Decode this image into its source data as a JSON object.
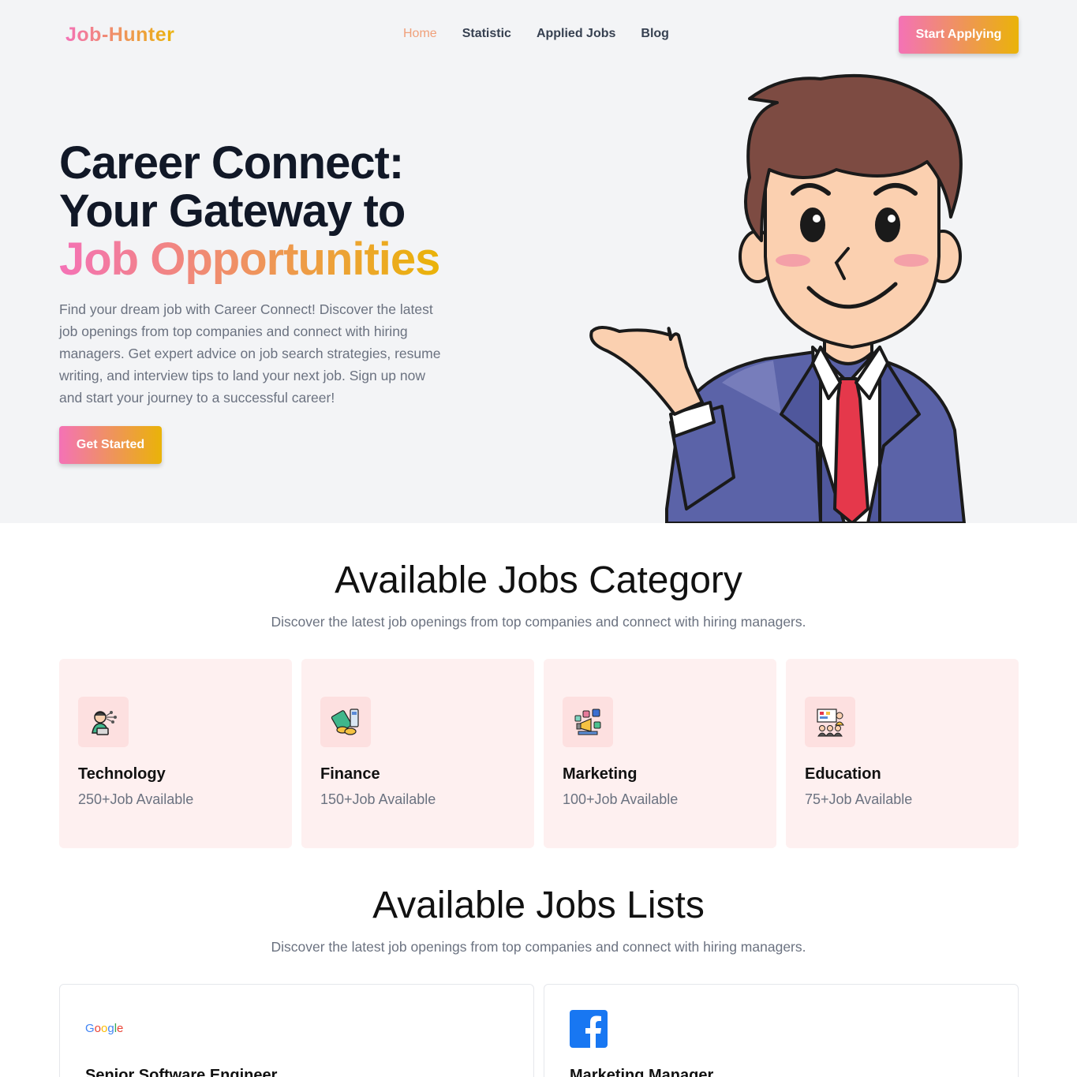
{
  "nav": {
    "logo": "Job-Hunter",
    "links": [
      "Home",
      "Statistic",
      "Applied Jobs",
      "Blog"
    ],
    "cta": "Start Applying"
  },
  "hero": {
    "title_line1": "Career Connect:",
    "title_line2": "Your Gateway to",
    "title_line3": "Job Opportunities",
    "description": "Find your dream job with Career Connect! Discover the latest job openings from top companies and connect with hiring managers. Get expert advice on job search strategies, resume writing, and interview tips to land your next job. Sign up now and start your journey to a successful career!",
    "cta": "Get Started"
  },
  "categories": {
    "title": "Available Jobs Category",
    "subtitle": "Discover the latest job openings from top companies and connect with hiring managers.",
    "items": [
      {
        "name": "Technology",
        "count": "250+Job Available",
        "icon": "technology-icon"
      },
      {
        "name": "Finance",
        "count": "150+Job Available",
        "icon": "finance-icon"
      },
      {
        "name": "Marketing",
        "count": "100+Job Available",
        "icon": "marketing-icon"
      },
      {
        "name": "Education",
        "count": "75+Job Available",
        "icon": "education-icon"
      }
    ]
  },
  "jobs": {
    "title": "Available Jobs Lists",
    "subtitle": "Discover the latest job openings from top companies and connect with hiring managers.",
    "items": [
      {
        "company": "Google",
        "title": "Senior Software Engineer",
        "logo": "google-logo"
      },
      {
        "company": "Facebook",
        "title": "Marketing Manager",
        "logo": "facebook-logo"
      }
    ]
  },
  "colors": {
    "gradient_start": "#f472b6",
    "gradient_end": "#eab308",
    "hero_bg": "#f3f4f6",
    "card_bg": "#fef0f0"
  }
}
